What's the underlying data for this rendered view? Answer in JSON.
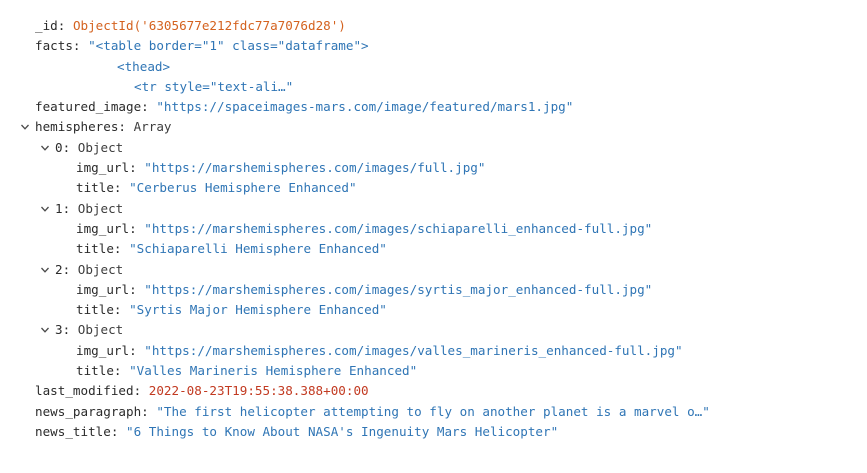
{
  "document": {
    "id_key": "_id:",
    "id_value": "ObjectId('6305677e212fdc77a7076d28')",
    "facts_key": "facts:",
    "facts_line1": "\"<table border=\"1\" class=\"dataframe\">",
    "facts_line2": "<thead>",
    "facts_line3": "<tr style=\"text-ali…\"",
    "featured_image_key": "featured_image:",
    "featured_image_value": "\"https://spaceimages-mars.com/image/featured/mars1.jpg\"",
    "hemispheres_key": "hemispheres:",
    "hemispheres_type": "Array",
    "hemispheres": [
      {
        "index_label": "0:",
        "type": "Object",
        "img_url_key": "img_url:",
        "img_url": "\"https://marshemispheres.com/images/full.jpg\"",
        "title_key": "title:",
        "title": "\"Cerberus Hemisphere Enhanced\""
      },
      {
        "index_label": "1:",
        "type": "Object",
        "img_url_key": "img_url:",
        "img_url": "\"https://marshemispheres.com/images/schiaparelli_enhanced-full.jpg\"",
        "title_key": "title:",
        "title": "\"Schiaparelli Hemisphere Enhanced\""
      },
      {
        "index_label": "2:",
        "type": "Object",
        "img_url_key": "img_url:",
        "img_url": "\"https://marshemispheres.com/images/syrtis_major_enhanced-full.jpg\"",
        "title_key": "title:",
        "title": "\"Syrtis Major Hemisphere Enhanced\""
      },
      {
        "index_label": "3:",
        "type": "Object",
        "img_url_key": "img_url:",
        "img_url": "\"https://marshemispheres.com/images/valles_marineris_enhanced-full.jpg\"",
        "title_key": "title:",
        "title": "\"Valles Marineris Hemisphere Enhanced\""
      }
    ],
    "last_modified_key": "last_modified:",
    "last_modified_value": "2022-08-23T19:55:38.388+00:00",
    "news_paragraph_key": "news_paragraph:",
    "news_paragraph_value": "\"The first helicopter attempting to fly on another planet is a marvel o…\"",
    "news_title_key": "news_title:",
    "news_title_value": "\"6 Things to Know About NASA's Ingenuity Mars Helicopter\""
  },
  "colors": {
    "key": "#2b2b2b",
    "object_id": "#d4621f",
    "string": "#2f75b5",
    "date": "#c23a21"
  },
  "icons": {
    "expand": "chevron-down-icon"
  }
}
